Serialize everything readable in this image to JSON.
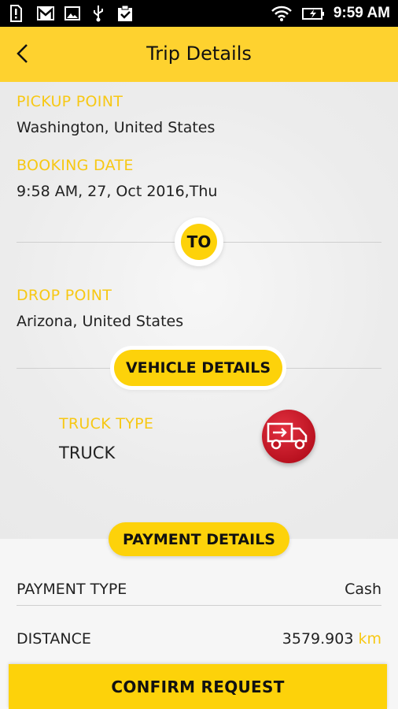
{
  "status_bar": {
    "time": "9:59 AM",
    "icons": [
      "alert-icon",
      "gmail-icon",
      "image-icon",
      "usb-icon",
      "clipboard-check-icon",
      "wifi-icon",
      "battery-charging-icon"
    ]
  },
  "header": {
    "title": "Trip Details",
    "back_icon": "chevron-left-icon"
  },
  "pickup": {
    "label": "PICKUP POINT",
    "value": "Washington, United States"
  },
  "booking": {
    "label": "BOOKING DATE",
    "value": "9:58 AM, 27, Oct 2016,Thu"
  },
  "to_badge": "TO",
  "drop": {
    "label": "DROP POINT",
    "value": "Arizona, United States"
  },
  "vehicle": {
    "section_title": "VEHICLE DETAILS",
    "type_label": "TRUCK TYPE",
    "type_value": "TRUCK",
    "icon": "truck-icon"
  },
  "payment": {
    "section_title": "PAYMENT DETAILS",
    "type_label": "PAYMENT TYPE",
    "type_value": "Cash",
    "distance_label": "DISTANCE",
    "distance_value": "3579.903",
    "distance_unit": "km"
  },
  "confirm_label": "CONFIRM REQUEST",
  "colors": {
    "accent": "#fed22f",
    "label": "#f7c814",
    "truck": "#c0111f"
  }
}
